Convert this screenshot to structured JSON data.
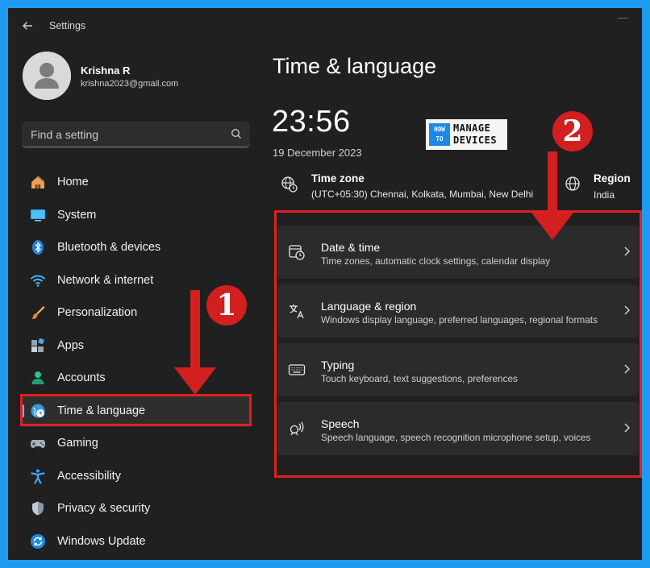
{
  "window": {
    "title": "Settings"
  },
  "profile": {
    "name": "Krishna R",
    "email": "krishna2023@gmail.com"
  },
  "search": {
    "placeholder": "Find a setting"
  },
  "nav": {
    "items": [
      {
        "label": "Home",
        "icon": "home-icon"
      },
      {
        "label": "System",
        "icon": "system-icon"
      },
      {
        "label": "Bluetooth & devices",
        "icon": "bluetooth-icon"
      },
      {
        "label": "Network & internet",
        "icon": "wifi-icon"
      },
      {
        "label": "Personalization",
        "icon": "brush-icon"
      },
      {
        "label": "Apps",
        "icon": "apps-icon"
      },
      {
        "label": "Accounts",
        "icon": "accounts-icon"
      },
      {
        "label": "Time & language",
        "icon": "time-language-icon",
        "active": true
      },
      {
        "label": "Gaming",
        "icon": "gamepad-icon"
      },
      {
        "label": "Accessibility",
        "icon": "accessibility-icon"
      },
      {
        "label": "Privacy & security",
        "icon": "shield-icon"
      },
      {
        "label": "Windows Update",
        "icon": "update-icon"
      }
    ]
  },
  "main": {
    "title": "Time & language",
    "clock": "23:56",
    "date": "19 December 2023",
    "timezone": {
      "label": "Time zone",
      "value": "(UTC+05:30) Chennai, Kolkata, Mumbai, New Delhi"
    },
    "region": {
      "label": "Region",
      "value": "India"
    },
    "options": [
      {
        "title": "Date & time",
        "desc": "Time zones, automatic clock settings, calendar display",
        "icon": "calendar-clock-icon"
      },
      {
        "title": "Language & region",
        "desc": "Windows display language, preferred languages, regional formats",
        "icon": "language-icon"
      },
      {
        "title": "Typing",
        "desc": "Touch keyboard, text suggestions, preferences",
        "icon": "keyboard-icon"
      },
      {
        "title": "Speech",
        "desc": "Speech language, speech recognition microphone setup, voices",
        "icon": "speech-icon"
      }
    ]
  },
  "logo": {
    "how": "HOW",
    "to": "TO",
    "manage": "MANAGE",
    "devices": "DEVICES"
  },
  "annotations": {
    "badge1": "1",
    "badge2": "2",
    "color": "#d21f1f"
  },
  "colors": {
    "accent": "#4cc2ff",
    "highlight": "#e02020",
    "window_bg": "#202020",
    "frame": "#1e9bf0"
  }
}
